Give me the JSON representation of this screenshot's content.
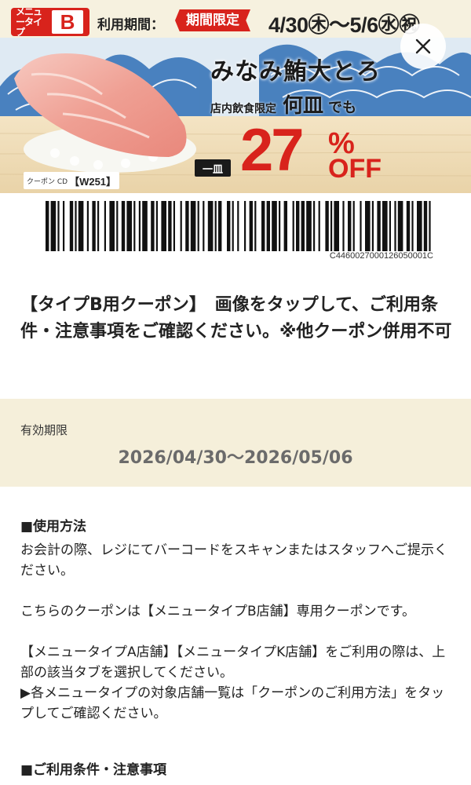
{
  "banner": {
    "menu_badge_text": "メニュータイプ",
    "menu_badge_letter": "B",
    "period_label": "利用期間：",
    "period_tag": "期間限定",
    "period_range": "4/30㊍〜5/6㊌㊗",
    "title": "みなみ鮪大とろ",
    "subtitle_prefix": "店内飲食限定",
    "subtitle_emphasis": "何皿",
    "subtitle_suffix": "でも",
    "per_plate": "一皿",
    "discount_number": "27",
    "discount_percent": "%",
    "discount_off": "OFF",
    "coupon_cd_label": "クーポン CD",
    "coupon_cd_value": "【W251】"
  },
  "barcode": {
    "number": "C4460027000126050001C"
  },
  "description": "【タイプB用クーポン】　画像をタップして、ご利用条件・注意事項をご確認ください。※他クーポン併用不可",
  "validity": {
    "label": "有効期限",
    "range": "2026/04/30〜2026/05/06"
  },
  "usage": {
    "title": "■使用方法",
    "p1": "お会計の際、レジにてバーコードをスキャンまたはスタッフへご提示ください。",
    "p2": "こちらのクーポンは【メニュータイプB店舗】専用クーポンです。",
    "p3": "【メニュータイプA店舗】【メニュータイプK店舗】をご利用の際は、上部の該当タブを選択してください。",
    "p4": "▶各メニュータイプの対象店舗一覧は「クーポンのご利用方法」をタップしてご確認ください。"
  },
  "conditions": {
    "title": "■ご利用条件・注意事項"
  },
  "colors": {
    "accent_red": "#d8231c",
    "validity_bg": "#f5efda",
    "wave_blue": "#2f6fb5"
  },
  "icons": {
    "close": "close-icon"
  }
}
